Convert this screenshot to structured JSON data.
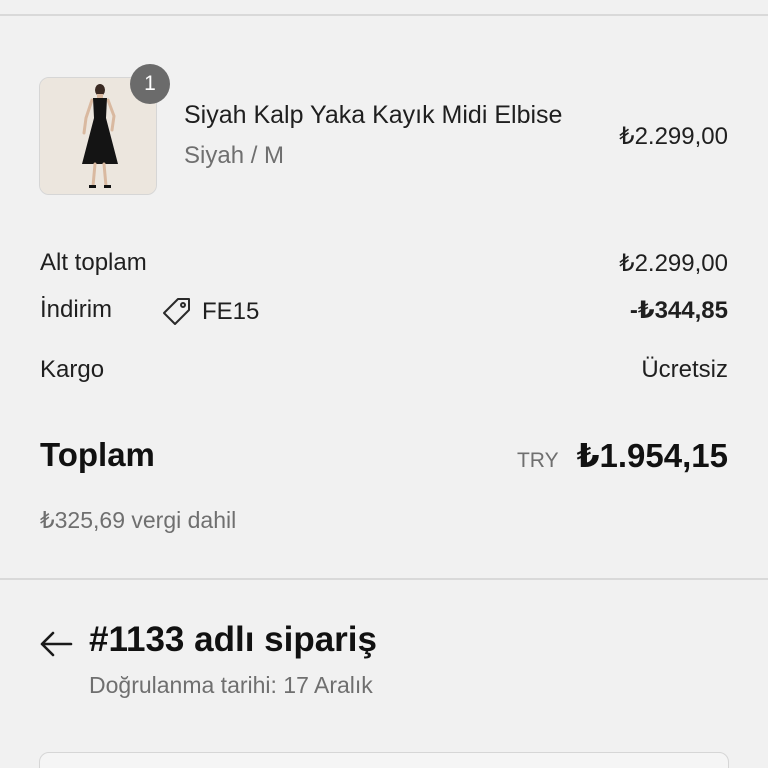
{
  "product": {
    "name": "Siyah Kalp Yaka Kayık Midi Elbise",
    "variant": "Siyah / M",
    "price": "₺2.299,00",
    "quantity": "1",
    "image_icon": "dress-photo"
  },
  "summary": {
    "subtotal_label": "Alt toplam",
    "subtotal_value": "₺2.299,00",
    "discount_label": "İndirim",
    "discount_code": "FE15",
    "discount_icon": "tag-icon",
    "discount_value": "-₺344,85",
    "shipping_label": "Kargo",
    "shipping_value": "Ücretsiz"
  },
  "total": {
    "label": "Toplam",
    "currency": "TRY",
    "amount": "₺1.954,15",
    "tax_note": "₺325,69 vergi dahil"
  },
  "order": {
    "title": "#1133 adlı sipariş",
    "subtitle": "Doğrulanma tarihi: 17 Aralık",
    "back_icon": "arrow-left-icon"
  }
}
